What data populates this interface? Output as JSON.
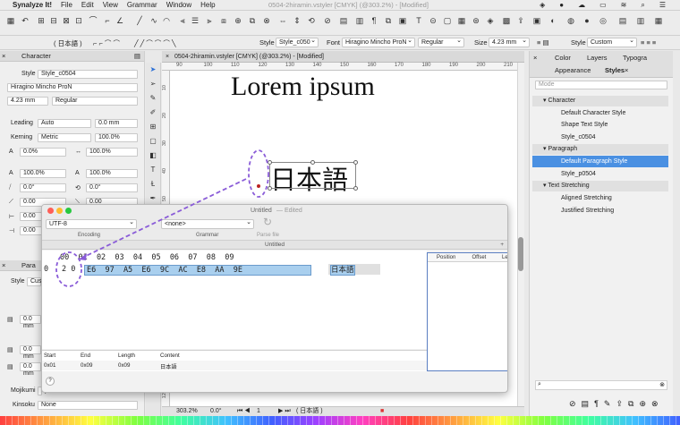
{
  "menubar": {
    "app": "Synalyze It!",
    "items": [
      "File",
      "Edit",
      "View",
      "Grammar",
      "Window",
      "Help"
    ],
    "doc_title": "0504-2hiramin.vstyler [CMYK] (@303.2%) - [Modified]"
  },
  "toolbar2": {
    "lang_pill": "( 日本語 )",
    "style_label": "Style",
    "style_value": "Style_c050",
    "font_label": "Font",
    "font_value": "Hiragino Mincho ProN",
    "weight_value": "Regular",
    "size_label": "Size",
    "size_value": "4.23 mm",
    "style2_label": "Style",
    "style2_value": "Custom"
  },
  "character_panel": {
    "title": "Character",
    "style_label": "Style",
    "style_value": "Style_c0504",
    "font": "Hiragino Mincho ProN",
    "size": "4.23 mm",
    "weight": "Regular",
    "leading_label": "Leading",
    "leading_value": "Auto",
    "leading_mm": "0.0 mm",
    "kerning_label": "Kerning",
    "kerning_value": "Metric",
    "kerning_pct": "100.0%",
    "tracking": "0.0%",
    "tracking2": "100.0%",
    "scale_h": "100.0%",
    "scale_v": "100.0%",
    "skew": "0.0°",
    "rot": "0.0°",
    "a1": "0.00",
    "a2": "0.00",
    "a3": "0.00",
    "a4": "0.00",
    "para_title": "Para",
    "para_style_label": "Style",
    "para_style_value": "Cust",
    "mm1": "0.0 mm",
    "mm2": "0.0 mm",
    "mm3": "0.0 mm",
    "mojikumi_label": "Mojikumi",
    "mojikumi_value": "Tyr",
    "kinsoku_label": "Kinsoku",
    "kinsoku_value": "None"
  },
  "document": {
    "tab_title": "0504-2hiramin.vstyler [CMYK] (@303.2%) - [Modified]",
    "ruler_marks": [
      "90",
      "100",
      "110",
      "120",
      "130",
      "140",
      "150",
      "160",
      "170",
      "180",
      "190",
      "200",
      "210"
    ],
    "ruler_v_marks": [
      "10",
      "20",
      "30",
      "40",
      "50",
      "60",
      "70",
      "80",
      "90",
      "100",
      "110",
      "120"
    ],
    "heading": "Lorem ipsum",
    "kanji": "日本語",
    "zoom": "303.2%",
    "angle": "0.0°",
    "page": "1",
    "lang": "( 日本語 )"
  },
  "dialog": {
    "title": "Untitled",
    "edited": "— Edited",
    "encoding_value": "UTF-8",
    "encoding_label": "Encoding",
    "grammar_value": "<none>",
    "grammar_label": "Grammar",
    "parse_label": "Parse file",
    "sub_title": "Untitled",
    "hex_header": "00  01  02  03  04  05  06  07  08  09",
    "hex_offset": "0",
    "hex_row": "E6  97  A5  E6  9C  AC  E8  AA  9E",
    "hex_first": "2 0",
    "text_col": "日本語",
    "info_cols": [
      "Position",
      "Offset",
      "Le"
    ],
    "table_cols": [
      "Start",
      "End",
      "Length",
      "Content"
    ],
    "table_row": [
      "0x01",
      "0x09",
      "0x09",
      "日本語"
    ],
    "help": "?"
  },
  "right_panel": {
    "tabs_top": [
      "Color",
      "Layers",
      "Typogra"
    ],
    "tabs_bottom": [
      "Appearance",
      "Styles"
    ],
    "mode": "Mode",
    "groups": [
      {
        "name": "Character",
        "items": [
          "Default Character Style",
          "Shape Text Style",
          "Style_c0504"
        ]
      },
      {
        "name": "Paragraph",
        "items": [
          "Default Paragraph Style",
          "Style_p0504"
        ]
      },
      {
        "name": "Text Stretching",
        "items": [
          "Aligned Stretching",
          "Justified Stretching"
        ]
      }
    ],
    "selected": "Default Paragraph Style"
  },
  "colors": {
    "accent": "#4a90e2",
    "annotation": "#8a5cd8",
    "hex_highlight": "#a9cfee"
  }
}
